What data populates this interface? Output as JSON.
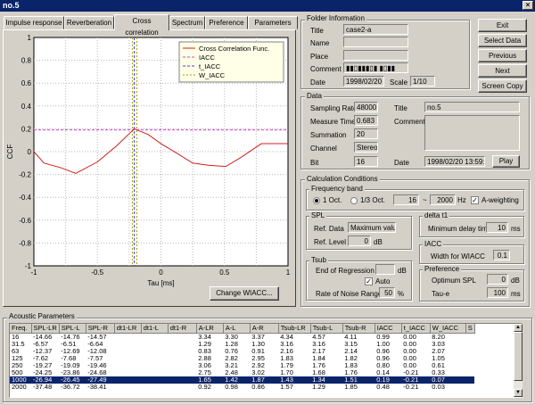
{
  "window": {
    "title": "no.5"
  },
  "tabs": [
    {
      "label": "Impulse response"
    },
    {
      "label": "Reverberation"
    },
    {
      "label": "Cross correlation"
    },
    {
      "label": "Spectrum"
    },
    {
      "label": "Preference"
    },
    {
      "label": "Parameters"
    }
  ],
  "chart_data": {
    "type": "line",
    "ylabel": "CCF",
    "xlabel": "Tau [ms]",
    "xlim": [
      -1,
      1
    ],
    "ylim": [
      -1,
      1
    ],
    "xticks": [
      "-1",
      "-0.5",
      "0",
      "0.5",
      "1"
    ],
    "yticks": [
      "1",
      "0.8",
      "0.6",
      "0.4",
      "0.2",
      "0",
      "-0.2",
      "-0.4",
      "-0.6",
      "-0.8",
      "-1"
    ],
    "legend": [
      "Cross Correlation Func.",
      "IACC",
      "t_IACC",
      "W_IACC"
    ],
    "series": [
      {
        "name": "Cross Correlation Func.",
        "x": [
          -1,
          -0.92,
          -0.79,
          -0.67,
          -0.5,
          -0.35,
          -0.21,
          -0.1,
          0.0,
          0.12,
          0.25,
          0.38,
          0.51,
          0.63,
          0.79,
          1.0
        ],
        "y": [
          0.0,
          -0.1,
          -0.14,
          -0.19,
          -0.09,
          0.05,
          0.2,
          0.15,
          0.07,
          -0.01,
          -0.1,
          -0.12,
          -0.13,
          -0.05,
          0.07,
          0.07
        ]
      }
    ],
    "iacc": 0.19,
    "t_iacc": -0.21,
    "w_iacc_range": [
      -0.225,
      -0.19
    ]
  },
  "buttons": {
    "change_wiacc": "Change WIACC...",
    "exit": "Exit",
    "select_data": "Select Data",
    "previous": "Previous",
    "next": "Next",
    "screen_copy": "Screen Copy",
    "play": "Play"
  },
  "folder": {
    "group": "Folder Information",
    "title_lbl": "Title",
    "title": "case2-a",
    "name_lbl": "Name",
    "place_lbl": "Place",
    "comment_lbl": "Comment",
    "comment": "▮▮▯▮▮▮▯▮ ▮▯▮▮",
    "date_lbl": "Date",
    "date": "1998/02/20",
    "scale_lbl": "Scale",
    "scale": "1/10"
  },
  "data": {
    "group": "Data",
    "sr_lbl": "Sampling Rate",
    "sr": "48000",
    "title_lbl": "Title",
    "title": "no.5",
    "mt_lbl": "Measure Time",
    "mt": "0.683",
    "comment_lbl": "Comment",
    "sum_lbl": "Summation",
    "sum": "20",
    "ch_lbl": "Channel",
    "ch": "Stereo",
    "bit_lbl": "Bit",
    "bit": "16",
    "date_lbl": "Date",
    "date": "1998/02/20 13:59:08"
  },
  "calc": {
    "group": "Calculation Conditions",
    "fb_group": "Frequency band",
    "oct1": "1 Oct.",
    "oct3": "1/3 Oct.",
    "f1": "16",
    "tilde": "~",
    "f2": "2000",
    "hz": "Hz",
    "aw": "A-weighting",
    "spl_group": "SPL",
    "ref_data_lbl": "Ref. Data",
    "ref_data": "Maximum value",
    "ref_level_lbl": "Ref. Level",
    "ref_level": "0",
    "db": "dB",
    "delta_group": "delta t1",
    "min_delay_lbl": "Minimum delay time",
    "min_delay": "10",
    "ms": "ms",
    "tsub_group": "Tsub",
    "end_reg_lbl": "End of Regression",
    "end_reg": "",
    "auto": "Auto",
    "rate_lbl": "Rate of Noise Range",
    "rate": "50",
    "pct": "%",
    "iacc_group": "IACC",
    "width_lbl": "Width for WIACC",
    "width": "0.1",
    "pref_group": "Preference",
    "opt_spl_lbl": "Optimum SPL",
    "opt_spl": "0",
    "opt_db": "dB",
    "taue_lbl": "Tau-e",
    "taue": "100",
    "taue_ms": "ms"
  },
  "acoustic": {
    "group": "Acoustic Parameters",
    "headers": [
      "Freq.",
      "SPL-LR",
      "SPL-L",
      "SPL-R",
      "dt1-LR",
      "dt1-L",
      "dt1-R",
      "A-LR",
      "A-L",
      "A-R",
      "Tsub-LR",
      "Tsub-L",
      "Tsub-R",
      "IACC",
      "t_IACC",
      "W_IACC",
      "S"
    ],
    "rows": [
      [
        "16",
        "-14.66",
        "-14.76",
        "-14.57",
        "",
        "",
        "",
        "3.34",
        "3.30",
        "3.37",
        "4.34",
        "4.57",
        "4.11",
        "0.99",
        "0.00",
        "8.20",
        ""
      ],
      [
        "31.5",
        "-6.57",
        "-6.51",
        "-6.64",
        "",
        "",
        "",
        "1.29",
        "1.28",
        "1.30",
        "3.16",
        "3.16",
        "3.15",
        "1.00",
        "0.00",
        "3.03",
        ""
      ],
      [
        "63",
        "-12.37",
        "-12.69",
        "-12.08",
        "",
        "",
        "",
        "0.83",
        "0.76",
        "0.91",
        "2.16",
        "2.17",
        "2.14",
        "0.96",
        "0.00",
        "2.07",
        ""
      ],
      [
        "125",
        "-7.62",
        "-7.68",
        "-7.57",
        "",
        "",
        "",
        "2.88",
        "2.82",
        "2.95",
        "1.83",
        "1.84",
        "1.82",
        "0.96",
        "0.00",
        "1.05",
        ""
      ],
      [
        "250",
        "-19.27",
        "-19.09",
        "-19.46",
        "",
        "",
        "",
        "3.06",
        "3.21",
        "2.92",
        "1.79",
        "1.76",
        "1.83",
        "0.80",
        "0.00",
        "0.61",
        ""
      ],
      [
        "500",
        "-24.25",
        "-23.86",
        "-24.68",
        "",
        "",
        "",
        "2.75",
        "2.48",
        "3.02",
        "1.70",
        "1.68",
        "1.76",
        "0.14",
        "-0.21",
        "0.33",
        ""
      ],
      [
        "1000",
        "-26.94",
        "-26.45",
        "-27.49",
        "",
        "",
        "",
        "1.65",
        "1.42",
        "1.87",
        "1.43",
        "1.34",
        "1.51",
        "0.19",
        "-0.21",
        "0.07",
        ""
      ],
      [
        "2000",
        "-37.48",
        "-36.72",
        "-38.41",
        "",
        "",
        "",
        "0.92",
        "0.98",
        "0.86",
        "1.57",
        "1.29",
        "1.85",
        "0.48",
        "-0.21",
        "0.03",
        ""
      ]
    ],
    "selected_row": 6
  }
}
